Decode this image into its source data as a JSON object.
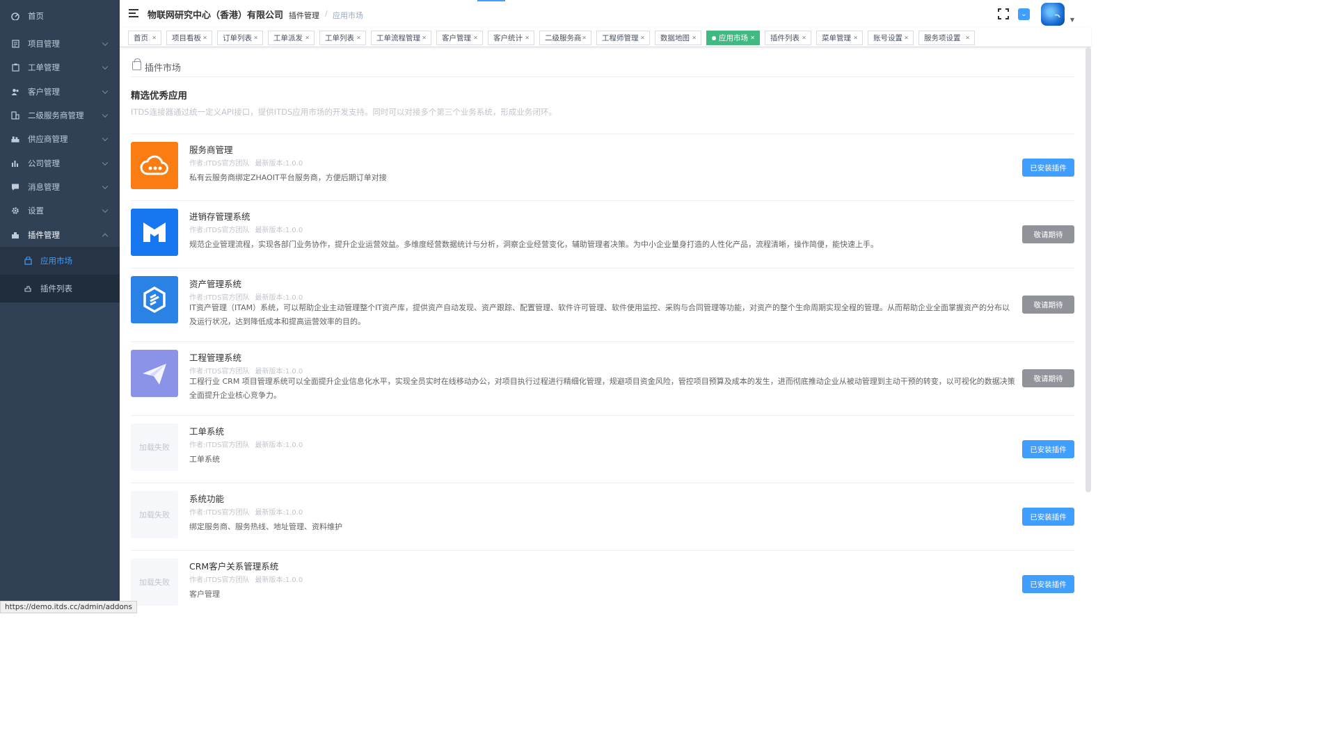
{
  "sidebar": {
    "home": {
      "label": "首页",
      "icon": "dashboard-icon"
    },
    "items": [
      {
        "label": "项目管理",
        "icon": "project-icon"
      },
      {
        "label": "工单管理",
        "icon": "ticket-icon"
      },
      {
        "label": "客户管理",
        "icon": "users-icon"
      },
      {
        "label": "二级服务商管理",
        "icon": "building-icon"
      },
      {
        "label": "供应商管理",
        "icon": "supplier-icon"
      },
      {
        "label": "公司管理",
        "icon": "chart-icon"
      },
      {
        "label": "消息管理",
        "icon": "message-icon"
      },
      {
        "label": "设置",
        "icon": "gear-icon"
      },
      {
        "label": "插件管理",
        "icon": "plugin-icon"
      }
    ],
    "sub_items": [
      {
        "label": "应用市场",
        "icon": "bag-icon"
      },
      {
        "label": "插件列表",
        "icon": "plugin-list-icon"
      }
    ]
  },
  "navbar": {
    "company": "物联网研究中心（香港）有限公司",
    "breadcrumb_parent": "插件管理",
    "breadcrumb_sep": "/",
    "breadcrumb_current": "应用市场"
  },
  "tags": [
    "首页",
    "项目看板",
    "订单列表",
    "工单派发",
    "工单列表",
    "工单流程管理",
    "客户管理",
    "客户统计",
    "二级服务商",
    "工程师管理",
    "数据地图",
    "应用市场",
    "插件列表",
    "菜单管理",
    "账号设置",
    "服务项设置"
  ],
  "active_tag": "应用市场",
  "main": {
    "card_title": "插件市场",
    "section_title": "精选优秀应用",
    "section_desc": "ITDS连接器通过统一定义API接口，提供ITDS应用市场的开发支持。同时可以对接多个第三个业务系统，形成业务闭环。"
  },
  "plugins": [
    {
      "name": "服务商管理",
      "author": "作者:ITDS官方团队",
      "version": "最新版本:1.0.0",
      "desc": "私有云服务商绑定ZHAOIT平台服务商，方便后期订单对接",
      "button": "已安装插件",
      "status": "installed",
      "logo": "cloud-icon",
      "logo_color": "#fa7d14"
    },
    {
      "name": "进销存管理系统",
      "author": "作者:ITDS官方团队",
      "version": "最新版本:1.0.0",
      "desc": "规范企业管理流程，实现各部门业务协作，提升企业运营效益。多维度经营数据统计与分析，洞察企业经营变化，辅助管理者决策。为中小企业量身打造的人性化产品，流程清晰，操作简便，能快速上手。",
      "button": "敬请期待",
      "status": "soon",
      "logo": "inventory-icon",
      "logo_color": "#1677f0"
    },
    {
      "name": "资产管理系统",
      "author": "作者:ITDS官方团队",
      "version": "最新版本:1.0.0",
      "desc": "IT资产管理（ITAM）系统，可以帮助企业主动管理整个IT资产库，提供资产自动发现、资产跟踪、配置管理、软件许可管理、软件使用监控、采购与合同管理等功能，对资产的整个生命周期实现全程的管理。从而帮助企业全面掌握资产的分布以及运行状况，达到降低成本和提高运营效率的目的。",
      "button": "敬请期待",
      "status": "soon",
      "logo": "asset-icon",
      "logo_color": "#2a82e4"
    },
    {
      "name": "工程管理系统",
      "author": "作者:ITDS官方团队",
      "version": "最新版本:1.0.0",
      "desc": "工程行业 CRM 项目管理系统可以全面提升企业信息化水平，实现全员实时在线移动办公，对项目执行过程进行精细化管理，规避项目资金风险，管控项目预算及成本的发生，进而彻底推动企业从被动管理到主动干预的转变，以可视化的数据决策全面提升企业核心竞争力。",
      "button": "敬请期待",
      "status": "soon",
      "logo": "paper-plane-icon",
      "logo_color": "#8a93e8"
    },
    {
      "name": "工单系统",
      "author": "作者:ITDS官方团队",
      "version": "最新版本:1.0.0",
      "desc": "工单系统",
      "button": "已安装插件",
      "status": "installed",
      "logo": "load-failed",
      "logo_text": "加载失败"
    },
    {
      "name": "系统功能",
      "author": "作者:ITDS官方团队",
      "version": "最新版本:1.0.0",
      "desc": "绑定服务商、服务热线、地址管理、资料维护",
      "button": "已安装插件",
      "status": "installed",
      "logo": "load-failed",
      "logo_text": "加载失败"
    },
    {
      "name": "CRM客户关系管理系统",
      "author": "作者:ITDS官方团队",
      "version": "最新版本:1.0.0",
      "desc": "客户管理",
      "button": "已安装插件",
      "status": "installed",
      "logo": "load-failed",
      "logo_text": "加载失败"
    }
  ],
  "status_url": "https://demo.itds.cc/admin/addons"
}
